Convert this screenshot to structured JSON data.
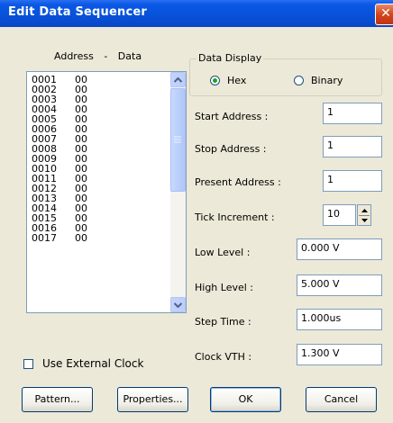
{
  "window": {
    "title": "Edit Data Sequencer",
    "close_glyph": "✕"
  },
  "list": {
    "header_address": "Address",
    "header_sep": "-",
    "header_data": "Data",
    "rows": [
      {
        "addr": "0001",
        "data": "00"
      },
      {
        "addr": "0002",
        "data": "00"
      },
      {
        "addr": "0003",
        "data": "00"
      },
      {
        "addr": "0004",
        "data": "00"
      },
      {
        "addr": "0005",
        "data": "00"
      },
      {
        "addr": "0006",
        "data": "00"
      },
      {
        "addr": "0007",
        "data": "00"
      },
      {
        "addr": "0008",
        "data": "00"
      },
      {
        "addr": "0009",
        "data": "00"
      },
      {
        "addr": "0010",
        "data": "00"
      },
      {
        "addr": "0011",
        "data": "00"
      },
      {
        "addr": "0012",
        "data": "00"
      },
      {
        "addr": "0013",
        "data": "00"
      },
      {
        "addr": "0014",
        "data": "00"
      },
      {
        "addr": "0015",
        "data": "00"
      },
      {
        "addr": "0016",
        "data": "00"
      },
      {
        "addr": "0017",
        "data": "00"
      }
    ]
  },
  "data_display": {
    "title": "Data Display",
    "hex_label": "Hex",
    "binary_label": "Binary",
    "selected": "Hex"
  },
  "fields": {
    "start_address": {
      "label": "Start Address :",
      "value": "1"
    },
    "stop_address": {
      "label": "Stop Address :",
      "value": "1"
    },
    "present_address": {
      "label": "Present Address :",
      "value": "1"
    },
    "tick_increment": {
      "label": "Tick Increment :",
      "value": "10"
    },
    "low_level": {
      "label": "Low Level :",
      "value": "0.000 V"
    },
    "high_level": {
      "label": "High Level :",
      "value": "5.000 V"
    },
    "step_time": {
      "label": "Step Time :",
      "value": "1.000us"
    },
    "clock_vth": {
      "label": "Clock VTH :",
      "value": "1.300 V"
    }
  },
  "external_clock": {
    "label": "Use External Clock",
    "checked": false
  },
  "buttons": {
    "pattern": "Pattern...",
    "properties": "Properties...",
    "ok": "OK",
    "cancel": "Cancel"
  },
  "icons": {
    "scroll_up": "chevron-up-icon",
    "scroll_down": "chevron-down-icon",
    "spin_up": "triangle-up-icon",
    "spin_down": "triangle-down-icon"
  }
}
